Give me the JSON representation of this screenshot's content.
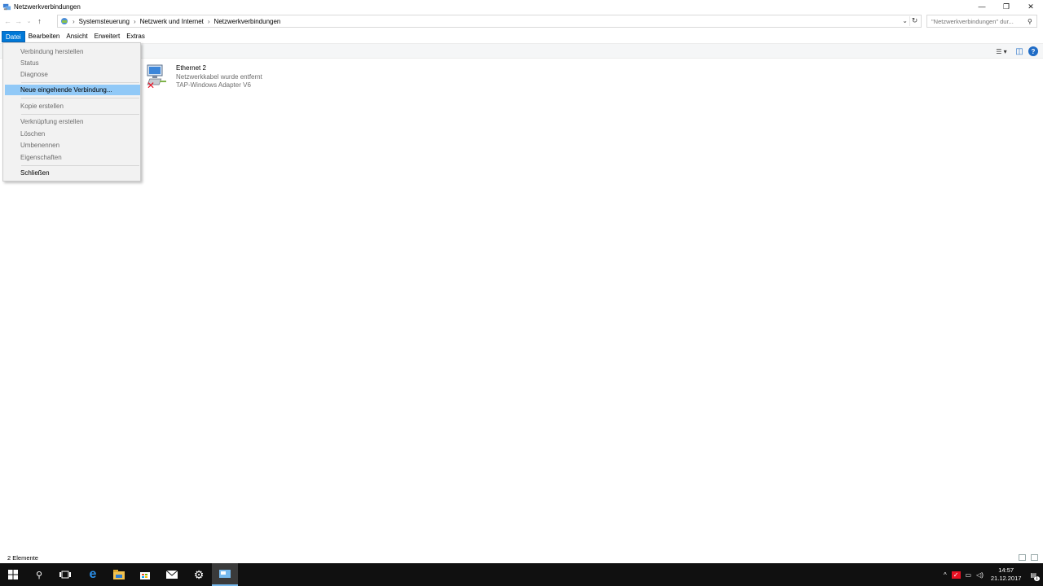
{
  "window": {
    "title": "Netzwerkverbindungen",
    "controls": {
      "minimize": "—",
      "maximize": "❐",
      "close": "✕"
    }
  },
  "address": {
    "back": "←",
    "forward": "→",
    "recent": "⌄",
    "up": "↑",
    "breadcrumbs": [
      "Systemsteuerung",
      "Netzwerk und Internet",
      "Netzwerkverbindungen"
    ],
    "dropdown": "⌄",
    "refresh": "↻"
  },
  "search": {
    "placeholder": "\"Netzwerkverbindungen\" dur...",
    "icon": "search-icon"
  },
  "menubar": {
    "items": [
      {
        "label": "Datei",
        "active": true
      },
      {
        "label": "Bearbeiten"
      },
      {
        "label": "Ansicht"
      },
      {
        "label": "Erweitert"
      },
      {
        "label": "Extras"
      }
    ]
  },
  "file_menu": {
    "items": [
      {
        "label": "Verbindung herstellen",
        "enabled": false
      },
      {
        "label": "Status",
        "enabled": false
      },
      {
        "label": "Diagnose",
        "enabled": false
      },
      {
        "label": "Neue eingehende Verbindung...",
        "enabled": true,
        "highlighted": true
      },
      {
        "label": "Kopie erstellen",
        "enabled": false
      },
      {
        "label": "Verknüpfung erstellen",
        "enabled": false
      },
      {
        "label": "Löschen",
        "enabled": false
      },
      {
        "label": "Umbenennen",
        "enabled": false
      },
      {
        "label": "Eigenschaften",
        "enabled": false
      },
      {
        "label": "Schließen",
        "enabled": true
      }
    ]
  },
  "connection": {
    "name": "Ethernet 2",
    "status": "Netzwerkkabel wurde entfernt",
    "adapter": "TAP-Windows Adapter V6",
    "error_mark": "✕"
  },
  "toolbar": {
    "view_options": "☰ ▾",
    "preview_pane": "◫",
    "help": "?"
  },
  "statusbar": {
    "count": "2 Elemente"
  },
  "taskbar": {
    "time": "14:57",
    "date": "21.12.2017",
    "notification_count": "1",
    "tray_chevron": "^"
  },
  "colors": {
    "accent": "#0078d7",
    "highlight": "#91c9f7",
    "taskbar": "#101010",
    "error": "#e81123"
  }
}
